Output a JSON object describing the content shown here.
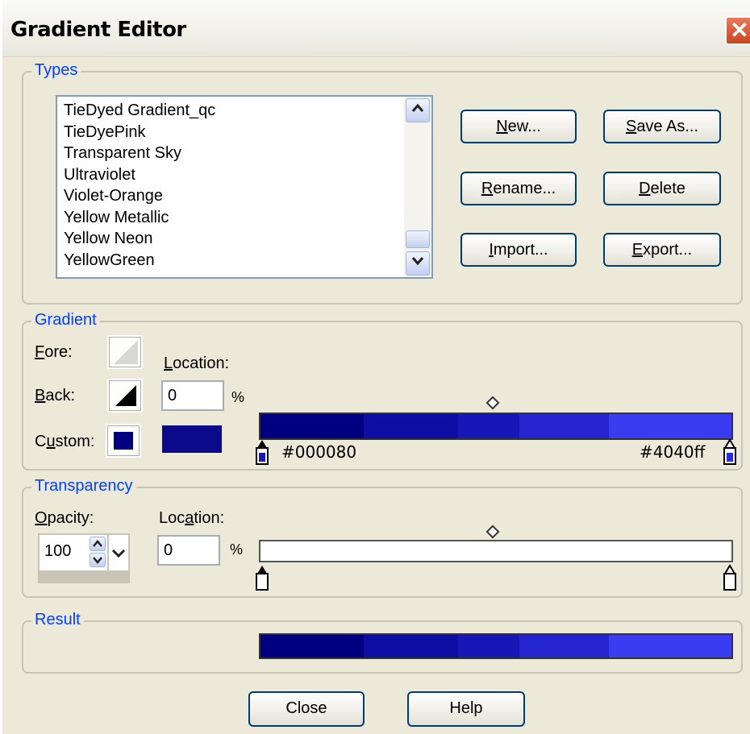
{
  "window": {
    "title": "Gradient Editor",
    "close_glyph": "✕"
  },
  "types": {
    "label": "Types",
    "items": [
      "TieDyed Gradient_qc",
      "TieDyePink",
      "Transparent Sky",
      "Ultraviolet",
      "Violet-Orange",
      "Yellow Metallic",
      "Yellow Neon",
      "YellowGreen"
    ],
    "buttons": {
      "new": {
        "u": "N",
        "rest": "ew..."
      },
      "save_as": {
        "u": "S",
        "rest": "ave As..."
      },
      "rename": {
        "u": "R",
        "rest": "ename..."
      },
      "delete": {
        "u": "D",
        "rest": "elete"
      },
      "import": {
        "u": "I",
        "rest": "mport..."
      },
      "export": {
        "u": "E",
        "rest": "xport..."
      }
    }
  },
  "gradient": {
    "label": "Gradient",
    "fore": {
      "u": "F",
      "rest": "ore:"
    },
    "back": {
      "u": "B",
      "rest": "ack:"
    },
    "custom": {
      "pre": "C",
      "u": "u",
      "rest": "stom:"
    },
    "location": {
      "u": "L",
      "rest": "ocation:"
    },
    "location_value": "0",
    "percent": "%",
    "left_color": "#000080",
    "right_color": "#4040ff",
    "custom_color": "#000080"
  },
  "transparency": {
    "label": "Transparency",
    "opacity": {
      "u": "O",
      "rest": "pacity:"
    },
    "opacity_value": "100",
    "location": {
      "pre": "Loc",
      "u": "a",
      "rest": "tion:"
    },
    "location_value": "0",
    "percent": "%"
  },
  "result": {
    "label": "Result"
  },
  "footer": {
    "close": "Close",
    "help": "Help"
  },
  "colors": {
    "bands": [
      "#000080",
      "#0a0aa0",
      "#1515b5",
      "#2020c8",
      "#2b2bd9",
      "#3535ea",
      "#4040ff"
    ],
    "accent": "#0040ff"
  }
}
